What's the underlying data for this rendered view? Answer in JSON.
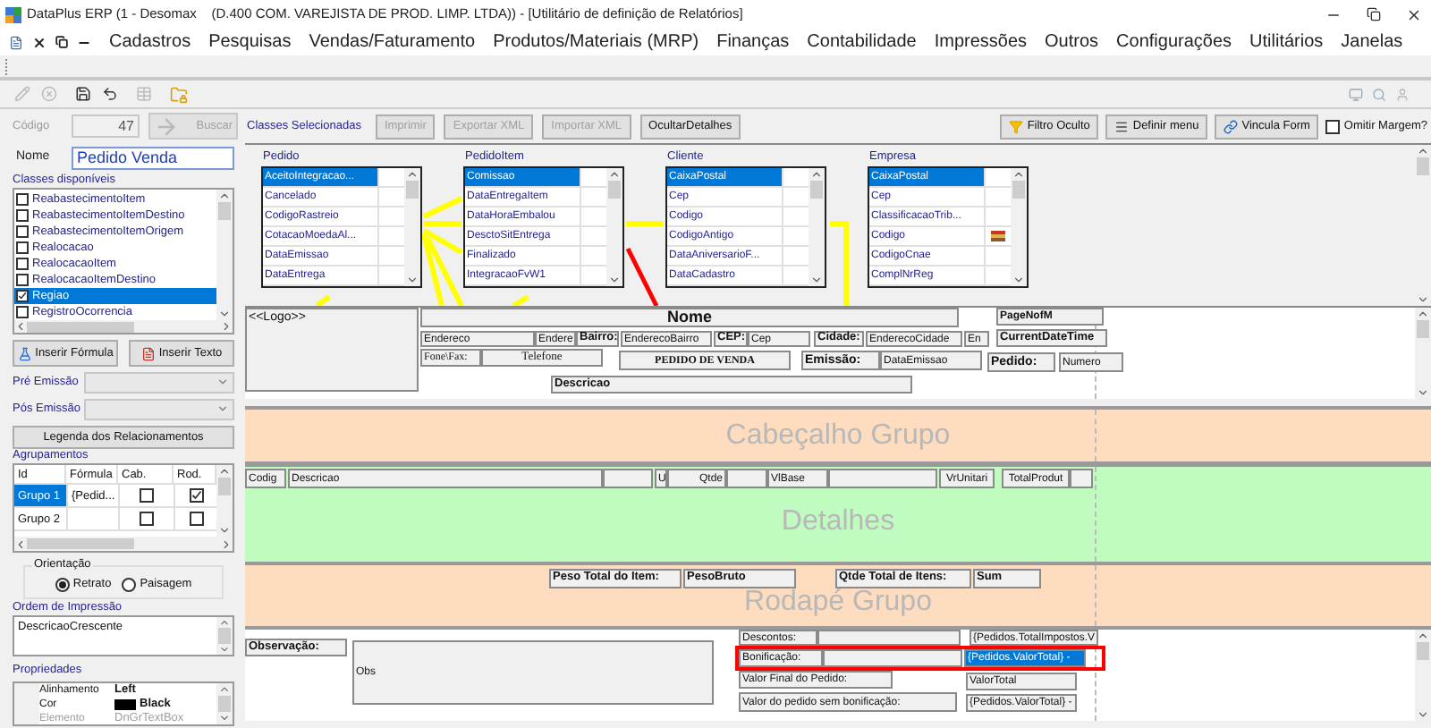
{
  "window": {
    "title": "DataPlus ERP (1 - Desomax    (D.400 COM. VAREJISTA DE PROD. LIMP. LTDA)) - [Utilitário de definição de Relatórios]"
  },
  "menu": {
    "items": [
      "Cadastros",
      "Pesquisas",
      "Vendas/Faturamento",
      "Produtos/Materiais (MRP)",
      "Finanças",
      "Contabilidade",
      "Impressões",
      "Outros",
      "Configurações",
      "Utilitários",
      "Janelas"
    ]
  },
  "header_row": {
    "code": {
      "label": "Código",
      "value": "47",
      "disabled": true
    },
    "search_button": {
      "label": "Buscar",
      "disabled": true
    },
    "selected_classes_label": "Classes Selecionadas",
    "buttons": [
      {
        "label": "Imprimir",
        "disabled": true
      },
      {
        "label": "Exportar XML",
        "disabled": true
      },
      {
        "label": "Importar XML",
        "disabled": true
      },
      {
        "label": "OcultarDetalhes",
        "disabled": false
      }
    ],
    "right_buttons": [
      {
        "label": "Filtro Oculto",
        "kind": "filter"
      },
      {
        "label": "Definir menu",
        "kind": "menu"
      },
      {
        "label": "Vincula Form",
        "kind": "form"
      }
    ],
    "omit_margin": {
      "label": "Omitir Margem?",
      "checked": false
    }
  },
  "name_field": {
    "label": "Nome",
    "value": "Pedido Venda"
  },
  "available_classes": {
    "label": "Classes disponíveis",
    "items": [
      {
        "name": "ReabastecimentoItem",
        "checked": false,
        "selected": false
      },
      {
        "name": "ReabastecimentoItemDestino",
        "checked": false,
        "selected": false
      },
      {
        "name": "ReabastecimentoItemOrigem",
        "checked": false,
        "selected": false
      },
      {
        "name": "Realocacao",
        "checked": false,
        "selected": false
      },
      {
        "name": "RealocacaoItem",
        "checked": false,
        "selected": false
      },
      {
        "name": "RealocacaoItemDestino",
        "checked": false,
        "selected": false
      },
      {
        "name": "Regiao",
        "checked": true,
        "selected": true
      },
      {
        "name": "RegistroOcorrencia",
        "checked": false,
        "selected": false
      }
    ]
  },
  "insert_buttons": [
    {
      "label": "Inserir Fórmula",
      "kind": "formula"
    },
    {
      "label": "Inserir Texto",
      "kind": "text"
    }
  ],
  "emission": [
    {
      "label": "Pré Emissão"
    },
    {
      "label": "Pós Emissão"
    }
  ],
  "legend_button": "Legenda dos Relacionamentos",
  "groupings": {
    "label": "Agrupamentos",
    "columns": [
      "Id",
      "Fórmula",
      "Cab.",
      "Rod."
    ],
    "rows": [
      {
        "id": "Grupo 1",
        "formula": "{Pedid...",
        "header": false,
        "footer": true,
        "selected": true
      },
      {
        "id": "Grupo 2",
        "header": false,
        "footer": false,
        "selected": false
      }
    ]
  },
  "orientation": {
    "label": "Orientação",
    "options": [
      {
        "label": "Retrato",
        "selected": true
      },
      {
        "label": "Paisagem",
        "selected": false
      }
    ]
  },
  "print_order": {
    "label": "Ordem de Impressão",
    "value": "DescricaoCrescente"
  },
  "properties": {
    "label": "Propriedades",
    "rows": [
      {
        "name": "Alinhamento",
        "value": "Left",
        "disabled": false
      },
      {
        "name": "Cor",
        "value": "Black",
        "color": "#000000",
        "disabled": false
      },
      {
        "name": "Elemento",
        "value": "DnGrTextBox",
        "disabled": true
      }
    ]
  },
  "class_diagram": {
    "classes": [
      {
        "title": "Pedido",
        "fields": [
          {
            "name": "AceitoIntegracao...",
            "selected": true,
            "icon": false
          },
          {
            "name": "Cancelado",
            "selected": false,
            "icon": false
          },
          {
            "name": "CodigoRastreio",
            "selected": false,
            "icon": false
          },
          {
            "name": "CotacaoMoedaAl...",
            "selected": false,
            "icon": false
          },
          {
            "name": "DataEmissao",
            "selected": false,
            "icon": false
          },
          {
            "name": "DataEntrega",
            "selected": false,
            "icon": false
          }
        ]
      },
      {
        "title": "PedidoItem",
        "fields": [
          {
            "name": "Comissao",
            "selected": true,
            "icon": false
          },
          {
            "name": "DataEntregaItem",
            "selected": false,
            "icon": false
          },
          {
            "name": "DataHoraEmbalou",
            "selected": false,
            "icon": false
          },
          {
            "name": "DesctoSitEntrega",
            "selected": false,
            "icon": false
          },
          {
            "name": "Finalizado",
            "selected": false,
            "icon": false
          },
          {
            "name": "IntegracaoFvW1",
            "selected": false,
            "icon": false
          }
        ]
      },
      {
        "title": "Cliente",
        "fields": [
          {
            "name": "CaixaPostal",
            "selected": true,
            "icon": false
          },
          {
            "name": "Cep",
            "selected": false,
            "icon": false
          },
          {
            "name": "Codigo",
            "selected": false,
            "icon": false
          },
          {
            "name": "CodigoAntigo",
            "selected": false,
            "icon": false
          },
          {
            "name": "DataAniversarioF...",
            "selected": false,
            "icon": false
          },
          {
            "name": "DataCadastro",
            "selected": false,
            "icon": false
          }
        ]
      },
      {
        "title": "Empresa",
        "fields": [
          {
            "name": "CaixaPostal",
            "selected": true,
            "icon": false
          },
          {
            "name": "Cep",
            "selected": false,
            "icon": false
          },
          {
            "name": "ClassificacaoTrib...",
            "selected": false,
            "icon": false
          },
          {
            "name": "Codigo",
            "selected": false,
            "icon": true
          },
          {
            "name": "CodigoCnae",
            "selected": false,
            "icon": false
          },
          {
            "name": "ComplNrReg",
            "selected": false,
            "icon": false
          }
        ]
      }
    ]
  },
  "report": {
    "page_header": {
      "items": [
        "<<Logo>>",
        "Nome",
        "PageNofM",
        "Endereco",
        "Endere",
        "Bairro:",
        "EnderecoBairro",
        "CEP:",
        "Cep",
        "Cidade:",
        "EnderecoCidade",
        "En",
        "CurrentDateTime",
        "Fone\\Fax:",
        "Telefone",
        "PEDIDO DE VENDA",
        "Emissão:",
        "DataEmissao",
        "Pedido:",
        "Numero",
        "Descricao"
      ]
    },
    "group_header": {
      "title": "Cabeçalho Grupo"
    },
    "detail": {
      "title": "Detalhes",
      "items": [
        "Codig",
        "Descricao",
        "U",
        "Qtde",
        "VlBase",
        "VrUnitari",
        "TotalProdut"
      ]
    },
    "group_footer": {
      "title": "Rodapé Grupo",
      "items": [
        "Peso Total do Item:",
        "PesoBruto",
        "Qtde Total de Itens:",
        "Sum"
      ]
    },
    "footer": {
      "items": [
        {
          "text": "Descontos:",
          "selected": false
        },
        {
          "text": "{Pedidos.TotalImpostos.V",
          "selected": false
        },
        {
          "text": "Observação:",
          "selected": false
        },
        {
          "text": "Obs",
          "selected": false
        },
        {
          "text": "Bonificação:",
          "selected": false
        },
        {
          "text": "{Pedidos.ValorTotal} -",
          "selected": true
        },
        {
          "text": "Valor Final do Pedido:",
          "selected": false
        },
        {
          "text": "ValorTotal",
          "selected": false
        },
        {
          "text": "Valor do pedido sem bonificação:",
          "selected": false
        },
        {
          "text": "{Pedidos.ValorTotal} -",
          "selected": false
        }
      ]
    }
  }
}
